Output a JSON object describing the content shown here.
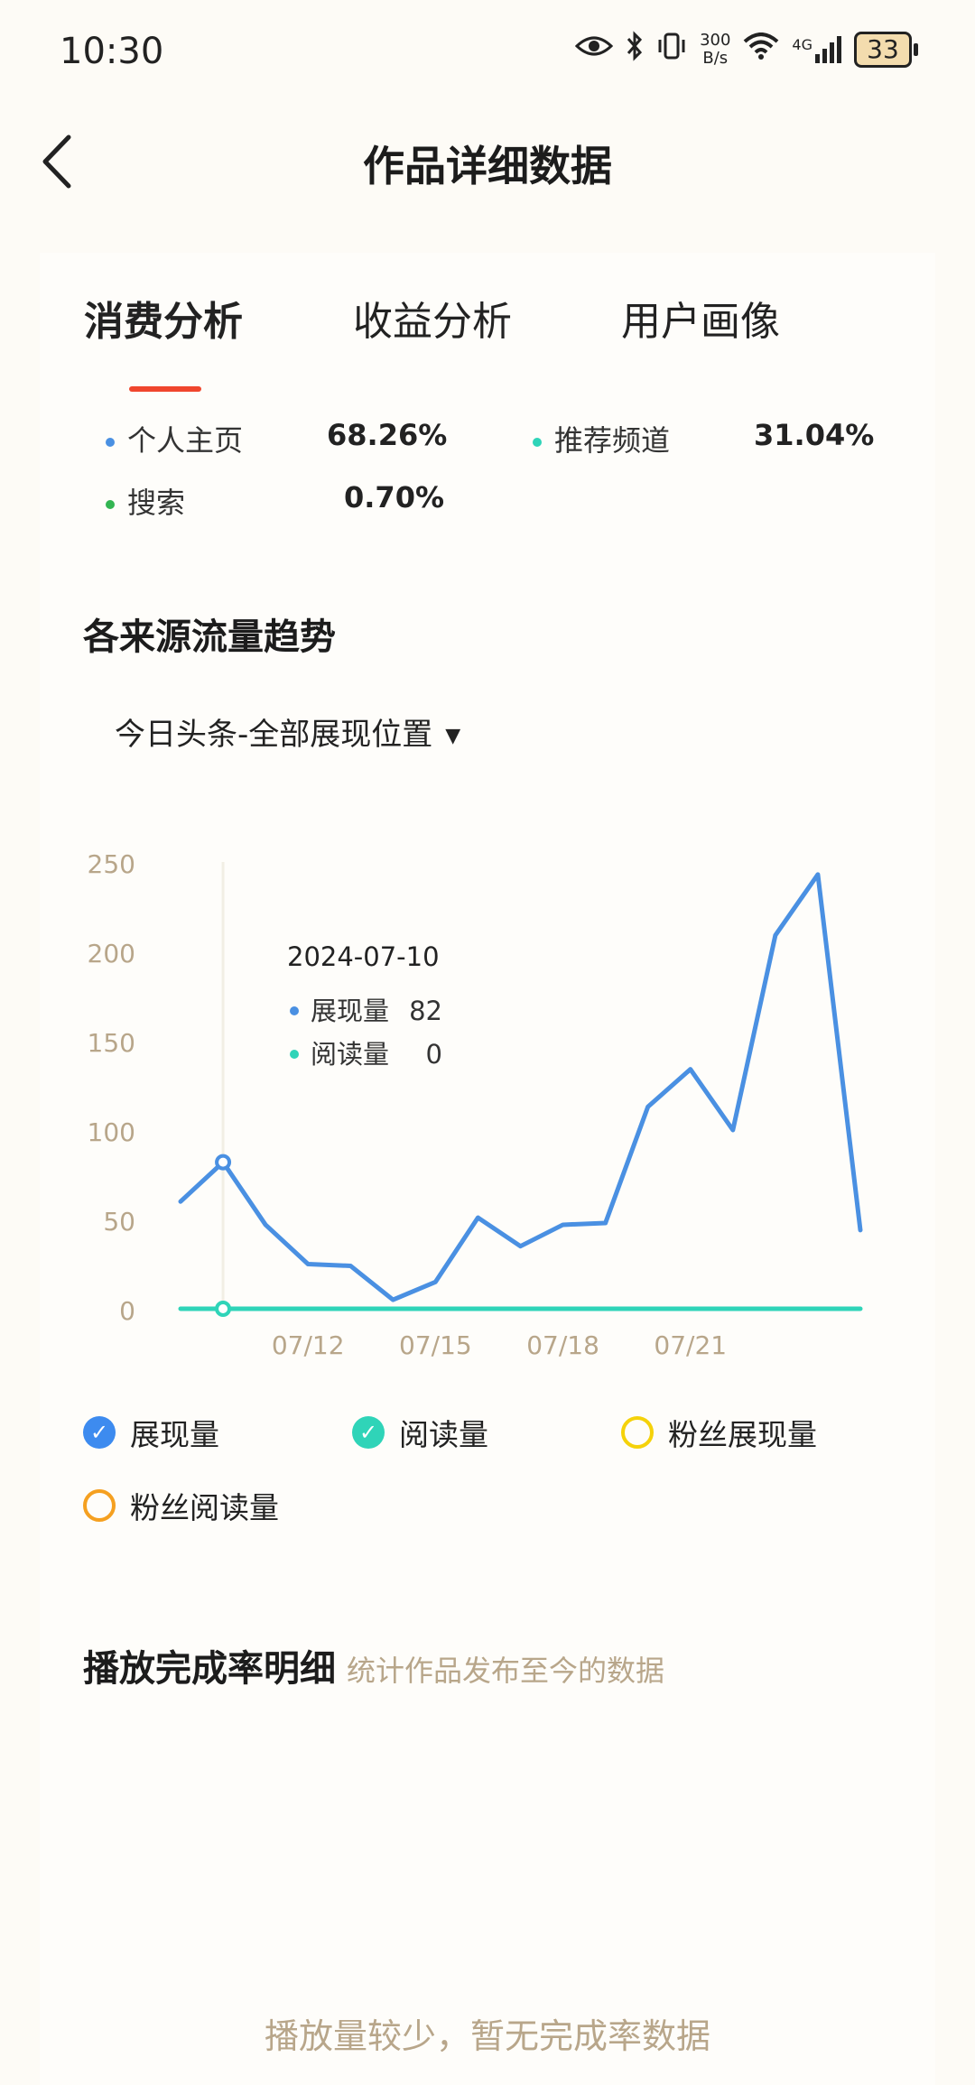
{
  "status": {
    "time": "10:30",
    "net_speed_value": "300",
    "net_speed_unit": "B/s",
    "network": "4G",
    "battery": "33"
  },
  "nav": {
    "title": "作品详细数据"
  },
  "tabs": [
    {
      "label": "消费分析"
    },
    {
      "label": "收益分析"
    },
    {
      "label": "用户画像"
    }
  ],
  "sources": [
    {
      "label": "个人主页",
      "value": "68.26%",
      "color": "#4a90e2"
    },
    {
      "label": "推荐频道",
      "value": "31.04%",
      "color": "#2fd4b8"
    },
    {
      "label": "搜索",
      "value": "0.70%",
      "color": "#33b552"
    }
  ],
  "trend": {
    "title": "各来源流量趋势",
    "select_label": "今日头条-全部展现位置"
  },
  "chart_data": {
    "type": "line",
    "x": [
      "07/09",
      "07/10",
      "07/11",
      "07/12",
      "07/13",
      "07/14",
      "07/15",
      "07/16",
      "07/17",
      "07/18",
      "07/19",
      "07/20",
      "07/21",
      "07/22",
      "07/23",
      "07/24",
      "07/25"
    ],
    "x_tick_labels": [
      "07/12",
      "07/15",
      "07/18",
      "07/21"
    ],
    "ylim": [
      0,
      250
    ],
    "y_ticks": [
      0,
      50,
      100,
      150,
      200,
      250
    ],
    "series": [
      {
        "name": "展现量",
        "color": "#4a90e2",
        "values": [
          60,
          82,
          47,
          25,
          24,
          5,
          15,
          51,
          35,
          47,
          48,
          113,
          134,
          100,
          209,
          243,
          44
        ]
      },
      {
        "name": "阅读量",
        "color": "#2fd4b8",
        "values": [
          0,
          0,
          0,
          0,
          0,
          0,
          0,
          0,
          0,
          0,
          0,
          0,
          0,
          0,
          0,
          0,
          0
        ]
      }
    ],
    "tooltip": {
      "index": 1,
      "date": "2024-07-10",
      "rows": [
        {
          "label": "展现量",
          "value": "82"
        },
        {
          "label": "阅读量",
          "value": "0"
        }
      ]
    }
  },
  "series_toggles": [
    {
      "label": "展现量",
      "checked": true,
      "color": "#3d8bef"
    },
    {
      "label": "阅读量",
      "checked": true,
      "color": "#2fd4b8"
    },
    {
      "label": "粉丝展现量",
      "checked": false,
      "color": "#f5d20a"
    },
    {
      "label": "粉丝阅读量",
      "checked": false,
      "color": "#f5a020"
    }
  ],
  "completion": {
    "title": "播放完成率明细",
    "subtitle": "统计作品发布至今的数据",
    "empty_message": "播放量较少，暂无完成率数据"
  }
}
